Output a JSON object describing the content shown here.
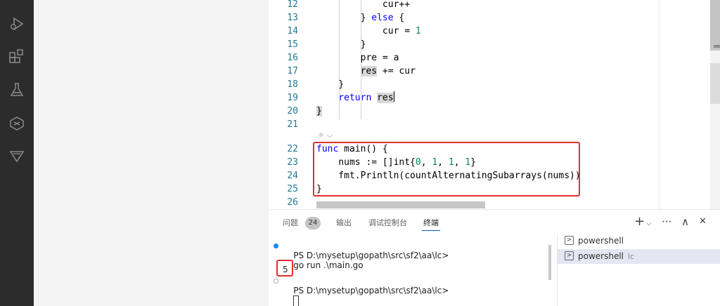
{
  "activity_bar": {
    "icons": [
      "run-debug-icon",
      "extensions-icon",
      "testing-icon",
      "remote-icon",
      "gitlens-icon"
    ]
  },
  "editor": {
    "codelens_icon": "sparkle-icon",
    "lines": [
      {
        "n": "12",
        "code": "            cur++"
      },
      {
        "n": "13",
        "code": "        } else {"
      },
      {
        "n": "14",
        "code": "            cur = 1"
      },
      {
        "n": "15",
        "code": "        }"
      },
      {
        "n": "16",
        "code": "        pre = a"
      },
      {
        "n": "17",
        "code": "        res += cur"
      },
      {
        "n": "18",
        "code": "    }"
      },
      {
        "n": "19",
        "code": "    return res"
      },
      {
        "n": "20",
        "code": "}"
      },
      {
        "n": "21",
        "code": ""
      },
      {
        "n": "22",
        "code": "func main() {"
      },
      {
        "n": "23",
        "code": "    nums := []int{0, 1, 1, 1}"
      },
      {
        "n": "24",
        "code": "    fmt.Println(countAlternatingSubarrays(nums))"
      },
      {
        "n": "25",
        "code": "}"
      },
      {
        "n": "26",
        "code": ""
      }
    ]
  },
  "panel": {
    "tabs": [
      {
        "label": "问题"
      },
      {
        "label": "输出"
      },
      {
        "label": "调试控制台"
      },
      {
        "label": "终端"
      }
    ],
    "problems_count": "24",
    "actions": {
      "add": "+",
      "dropdown": "⌵",
      "more": "···",
      "maximize": "∧",
      "close": "✕"
    },
    "terminal": {
      "prompt": "PS D:\\mysetup\\gopath\\src\\sf2\\aa\\lc>",
      "command": "go run .\\main.go",
      "output": "5",
      "prompt2": "PS D:\\mysetup\\gopath\\src\\sf2\\aa\\lc>"
    },
    "terminal_list": [
      {
        "name": "powershell",
        "sub": ""
      },
      {
        "name": "powershell",
        "sub": "lc"
      }
    ],
    "colors": {
      "success_dot": "#1a85ff",
      "accent": "#005fb8",
      "highlight_box": "#e03030"
    }
  }
}
